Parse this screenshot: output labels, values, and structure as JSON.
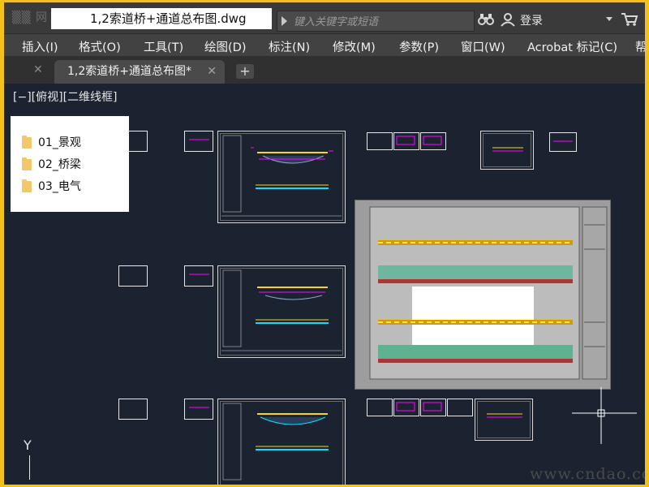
{
  "app": {
    "document_title": "1,2索道桥+通道总布图.dwg",
    "search_placeholder": "键入关键字或短语",
    "login_label": "登录"
  },
  "menu": {
    "items": [
      "插入(I)",
      "格式(O)",
      "工具(T)",
      "绘图(D)",
      "标注(N)",
      "修改(M)",
      "参数(P)",
      "窗口(W)",
      "Acrobat 标记(C)",
      "帮"
    ]
  },
  "tabs": {
    "active_label": "1,2索道桥+通道总布图*"
  },
  "viewport": {
    "label": "[−][俯视][二维线框]"
  },
  "folders": {
    "items": [
      "01_景观",
      "02_桥梁",
      "03_电气"
    ]
  },
  "watermark": "www.cndao.com",
  "ucs": {
    "y_label": "Y"
  },
  "colors": {
    "canvas": "#1b2330",
    "outer_border": "#f3c11a",
    "titlebar": "#3a3a3a",
    "menubar": "#424242",
    "magenta_markup": "#ff00ff",
    "yellow_markup": "#ffd700",
    "cyan_markup": "#00e5ff",
    "green_markup": "#2ea86b"
  }
}
